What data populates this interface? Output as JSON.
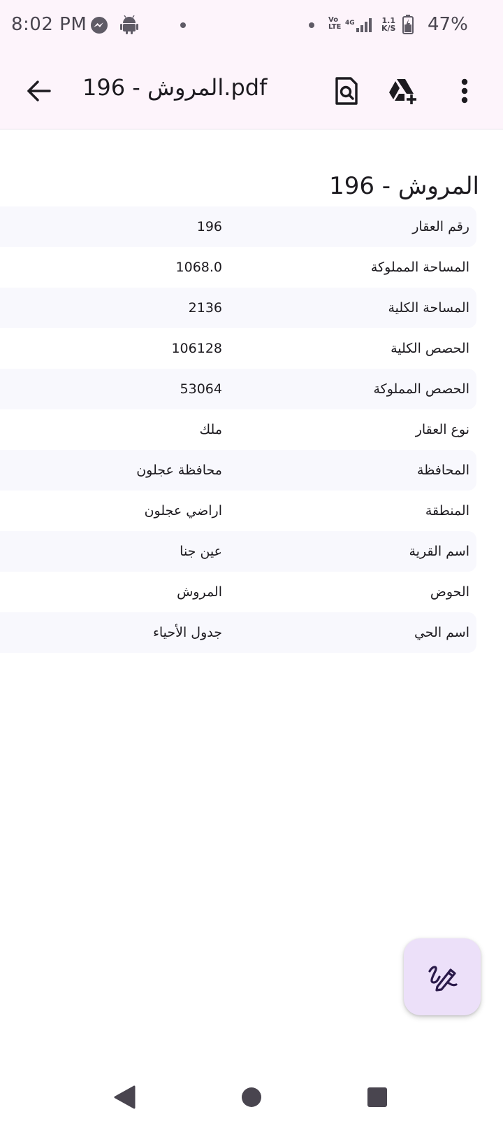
{
  "status_bar": {
    "time": "8:02 PM",
    "network_top": "Vo",
    "network_bottom": "LTE",
    "network_gen": "4G",
    "speed_top": "1.1",
    "speed_bottom": "K/S",
    "battery": "47%"
  },
  "app_bar": {
    "title": "المروش - 196.pdf"
  },
  "document": {
    "title": "المروش - 196",
    "rows": [
      {
        "label": "رقم العقار",
        "value": "196"
      },
      {
        "label": "المساحة المملوكة",
        "value": "1068.0"
      },
      {
        "label": "المساحة الكلية",
        "value": "2136"
      },
      {
        "label": "الحصص الكلية",
        "value": "106128"
      },
      {
        "label": "الحصص المملوكة",
        "value": "53064"
      },
      {
        "label": "نوع العقار",
        "value": "ملك"
      },
      {
        "label": "المحافظة",
        "value": "محافظة عجلون"
      },
      {
        "label": "المنطقة",
        "value": "اراضي عجلون"
      },
      {
        "label": "اسم القرية",
        "value": "عين جنا"
      },
      {
        "label": "الحوض",
        "value": "المروش"
      },
      {
        "label": "اسم الحي",
        "value": "جدول الأحياء"
      }
    ]
  },
  "colors": {
    "appbar_bg": "#fdf4fb",
    "row_shade": "#f8f8fd",
    "fab_bg": "#ece0f9",
    "fab_icon": "#2a1a4a"
  },
  "icons": {
    "back": "arrow-back-icon",
    "preview": "document-search-icon",
    "drive": "drive-add-icon",
    "more": "more-vert-icon",
    "fab": "draw-icon"
  }
}
